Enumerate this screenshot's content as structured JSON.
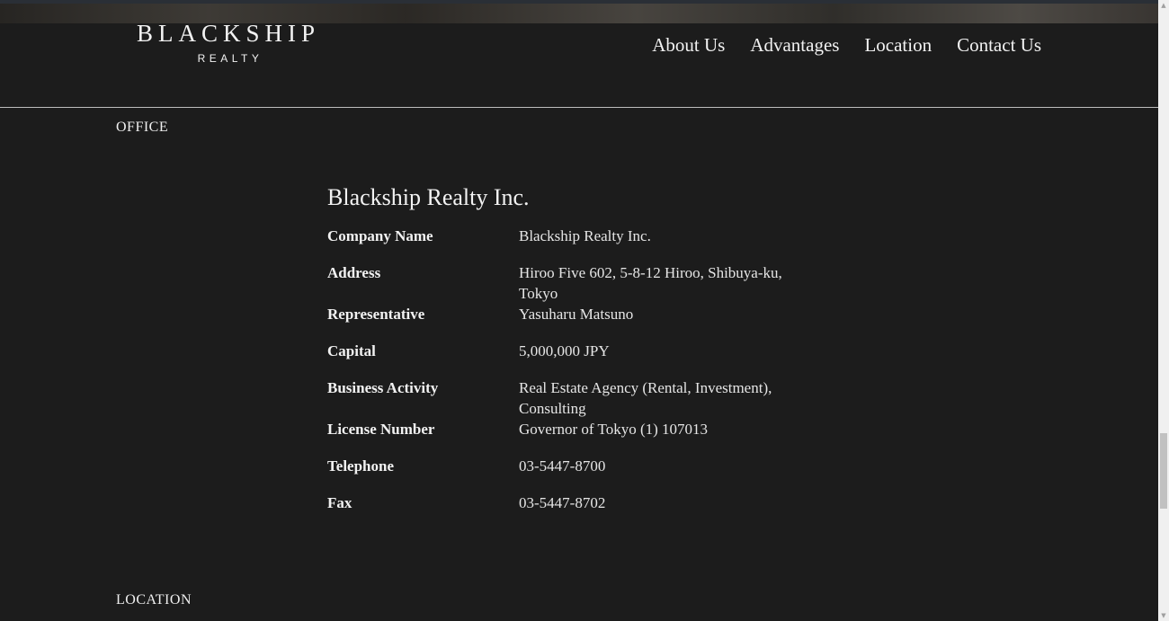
{
  "header": {
    "logo_main": "BLACKSHIP",
    "logo_sub": "REALTY",
    "nav": [
      {
        "label": "About Us"
      },
      {
        "label": "Advantages"
      },
      {
        "label": "Location"
      },
      {
        "label": "Contact Us"
      }
    ]
  },
  "office": {
    "section_label": "OFFICE",
    "company_title": "Blackship Realty Inc.",
    "rows": [
      {
        "key": "Company Name",
        "value": "Blackship Realty Inc."
      },
      {
        "key": "Address",
        "value": "Hiroo Five 602, 5-8-12 Hiroo, Shibuya-ku, Tokyo"
      },
      {
        "key": "Representative",
        "value": "Yasuharu Matsuno"
      },
      {
        "key": "Capital",
        "value": "5,000,000 JPY"
      },
      {
        "key": "Business Activity",
        "value": "Real Estate Agency (Rental, Investment), Consulting"
      },
      {
        "key": "License Number",
        "value": "Governor of Tokyo (1) 107013"
      },
      {
        "key": "Telephone",
        "value": "03-5447-8700"
      },
      {
        "key": "Fax",
        "value": "03-5447-8702"
      }
    ]
  },
  "location": {
    "section_label": "LOCATION"
  },
  "icons": {
    "scroll_up": "scroll-up-arrow-icon",
    "scroll_down": "scroll-down-arrow-icon"
  }
}
